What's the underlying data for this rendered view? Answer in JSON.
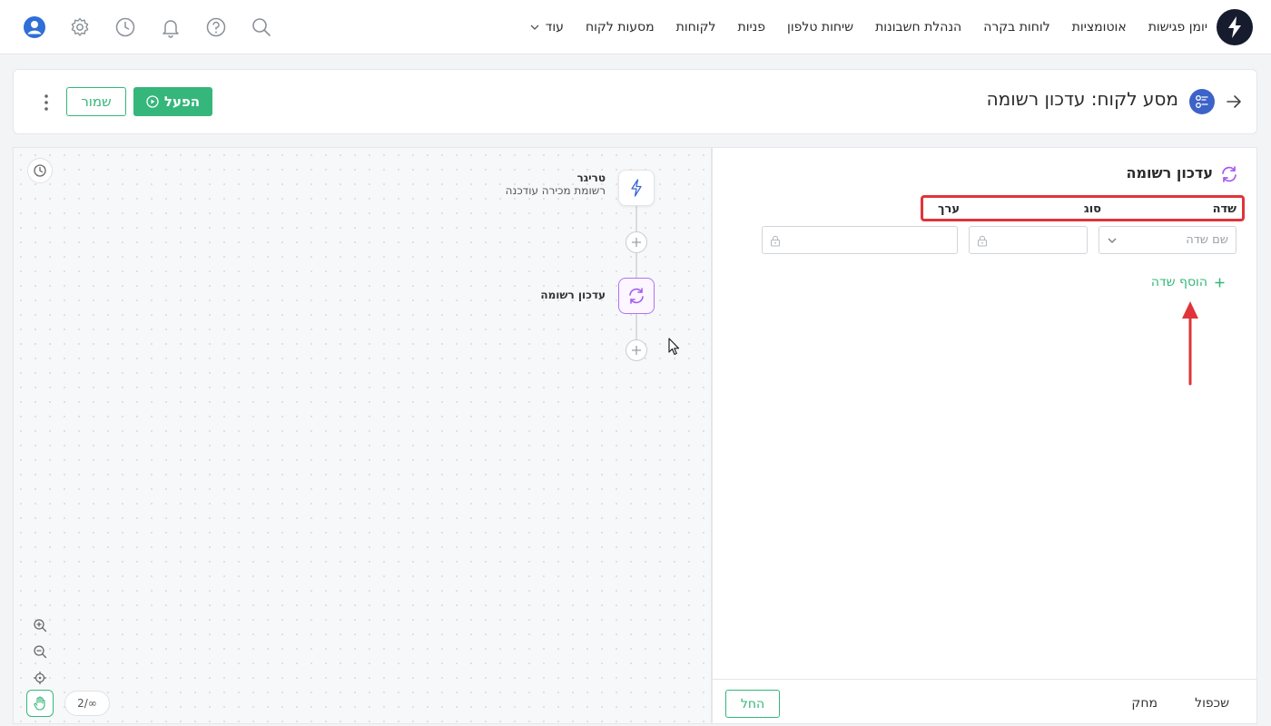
{
  "nav": {
    "items": [
      "יומן פגישות",
      "אוטומציות",
      "לוחות בקרה",
      "הנהלת חשבונות",
      "שיחות טלפון",
      "פניות",
      "לקוחות",
      "מסעות לקוח"
    ],
    "more_label": "עוד"
  },
  "header": {
    "title": "מסע לקוח: עדכון רשומה",
    "run_label": "הפעל",
    "save_label": "שמור"
  },
  "flow": {
    "trigger_title": "טריגר",
    "trigger_subtitle": "רשומת מכירה עודכנה",
    "update_title": "עדכון רשומה",
    "page_indicator": "2/∞"
  },
  "panel": {
    "title": "עדכון רשומה",
    "columns": {
      "field": "שדה",
      "type": "סוג",
      "value": "ערך"
    },
    "field_placeholder": "שם שדה",
    "add_field_label": "הוסף שדה",
    "duplicate_label": "שכפול",
    "delete_label": "מחק",
    "apply_label": "החל"
  },
  "colors": {
    "accent": "#35b67a",
    "annotation": "#e0343a",
    "purple": "#a55bf0",
    "blue": "#3a66d6"
  },
  "icons": [
    "logo-icon",
    "user-icon",
    "gear-icon",
    "clock-icon",
    "bell-icon",
    "help-icon",
    "search-icon",
    "chevron-down-icon",
    "arrow-right-icon",
    "journey-icon",
    "play-circle-icon",
    "kebab-icon",
    "history-icon",
    "lightning-icon",
    "refresh-icon",
    "plus-icon",
    "zoom-in-icon",
    "zoom-out-icon",
    "crosshair-icon",
    "hand-icon",
    "lock-icon"
  ]
}
